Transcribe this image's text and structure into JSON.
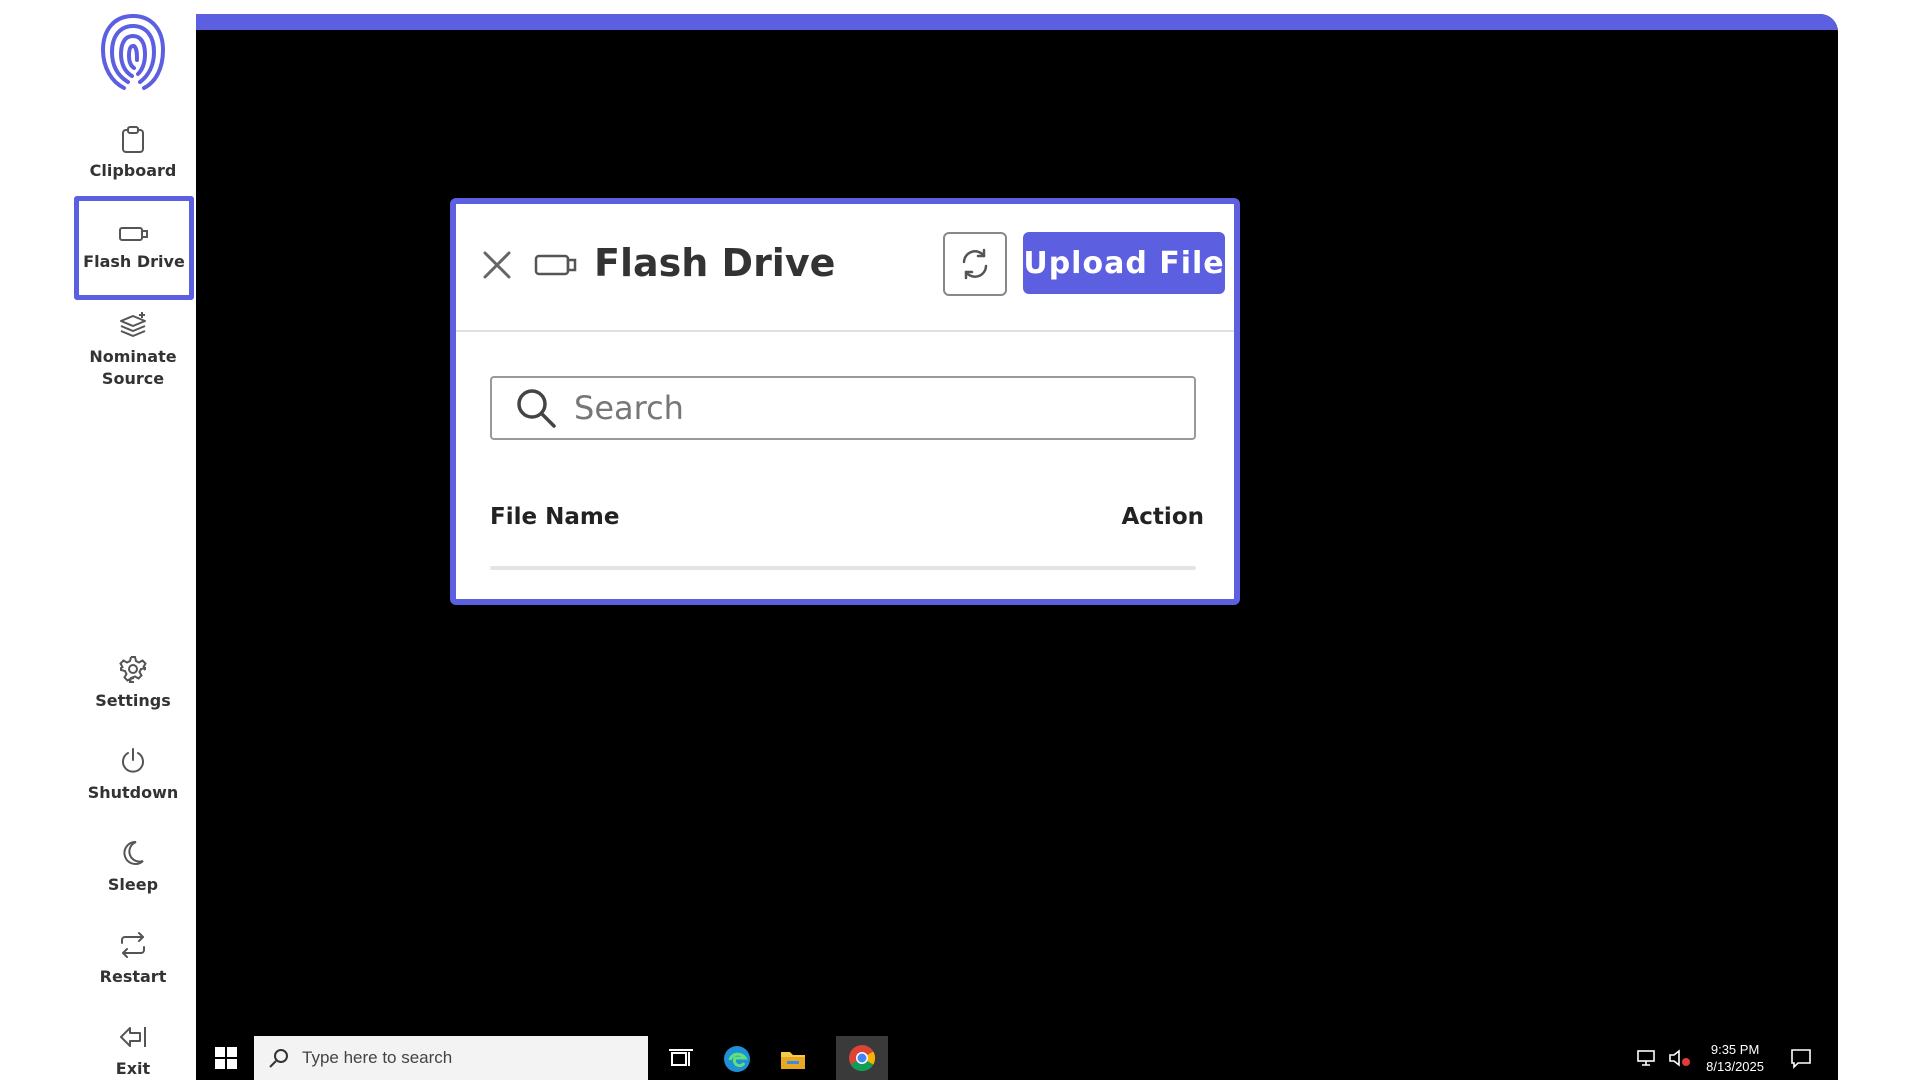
{
  "sidebar": {
    "items_top": [
      {
        "label": "Clipboard",
        "icon": "clipboard-icon"
      },
      {
        "label": "Flash Drive",
        "icon": "flash-drive-icon",
        "active": true
      },
      {
        "label": "Nominate\nSource",
        "icon": "layers-icon"
      }
    ],
    "items_bottom": [
      {
        "label": "Settings",
        "icon": "gear-icon"
      },
      {
        "label": "Shutdown",
        "icon": "power-icon"
      },
      {
        "label": "Sleep",
        "icon": "moon-icon"
      },
      {
        "label": "Restart",
        "icon": "restart-icon"
      },
      {
        "label": "Exit",
        "icon": "exit-icon"
      }
    ]
  },
  "panel": {
    "title": "Flash Drive",
    "upload_label": "Upload File",
    "search_placeholder": "Search",
    "columns": {
      "name": "File Name",
      "action": "Action"
    }
  },
  "taskbar": {
    "search_placeholder": "Type here to search",
    "time": "9:35 PM",
    "date": "8/13/2025"
  },
  "colors": {
    "accent": "#5b5fe0",
    "desktop": "#000000"
  }
}
